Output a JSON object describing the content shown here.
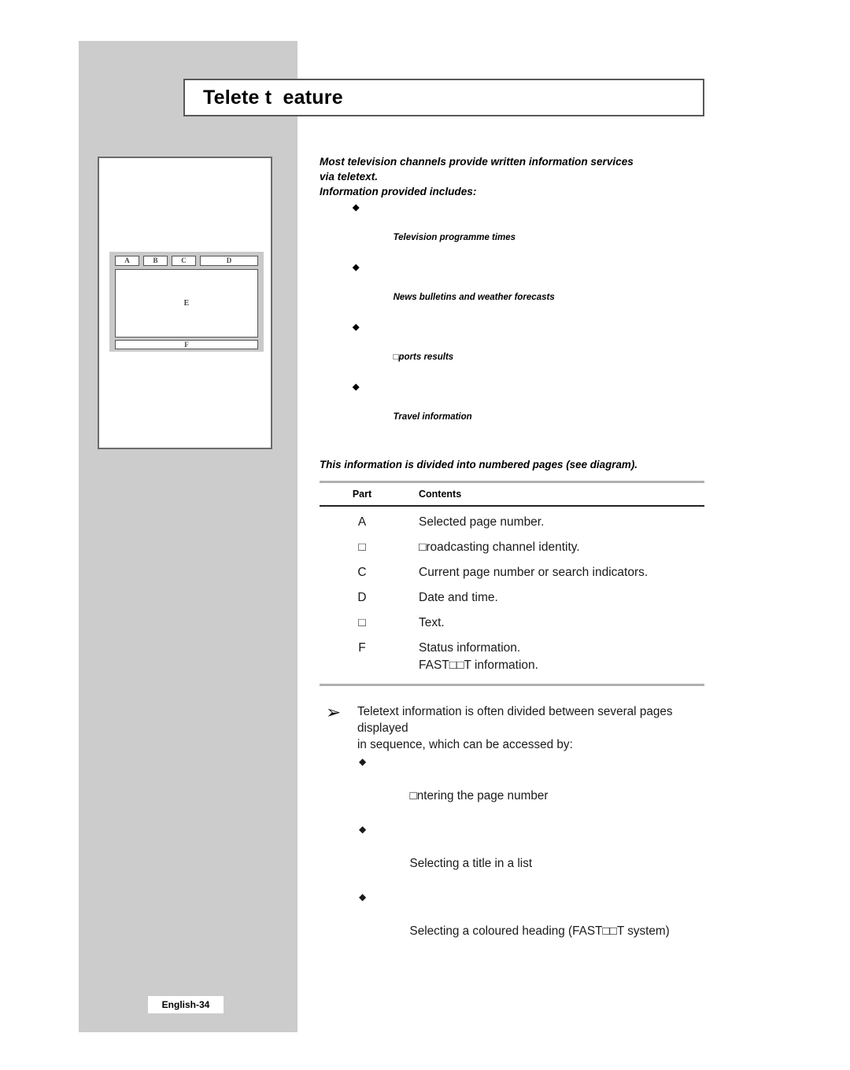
{
  "page": {
    "title": "Telete t  eature",
    "footer_label": "English-34"
  },
  "intro": {
    "line1": "Most television channels provide written information services",
    "line2": "via teletext.",
    "line3": "Information provided includes:",
    "bullets": [
      {
        "glyph": "◆",
        "text": "Television programme times"
      },
      {
        "glyph": "◆",
        "text": "News bulletins and weather forecasts"
      },
      {
        "glyph": "◆",
        "text": "□ports results"
      },
      {
        "glyph": "◆",
        "text": "Travel information"
      }
    ]
  },
  "divided_note": "This information is divided into numbered pages (see diagram).",
  "table": {
    "headers": {
      "part": "Part",
      "contents": "Contents"
    },
    "rows": [
      {
        "part": "A",
        "contents": "Selected page number."
      },
      {
        "part": "□",
        "contents": "□roadcasting channel identity."
      },
      {
        "part": "C",
        "contents": "Current page number or search indicators."
      },
      {
        "part": "D",
        "contents": "Date and time."
      },
      {
        "part": "□",
        "contents": "Text."
      },
      {
        "part": "F",
        "contents": "Status information.\nFAST□□T information."
      }
    ]
  },
  "closing": {
    "arrow_glyph": "➢",
    "paragraph": "Teletext information is often divided between several pages displayed\nin sequence, which can be accessed by:",
    "bullets": [
      {
        "glyph": "◆",
        "text": "□ntering the page number"
      },
      {
        "glyph": "◆",
        "text": "Selecting a title in a list"
      },
      {
        "glyph": "◆",
        "text": "Selecting a coloured heading (FAST□□T system)"
      }
    ]
  },
  "diagram": {
    "top_cells": [
      {
        "label": "A"
      },
      {
        "label": "B"
      },
      {
        "label": "C"
      },
      {
        "label": "D"
      }
    ],
    "screen_label": "E",
    "bottom_label": "F"
  },
  "colors": {
    "band": "#cccccc",
    "panel": "#c9c9c9",
    "rule_grey": "#b0b0b0",
    "rule_black": "#222222",
    "text": "#1a1a1a",
    "missing_glyph": "#b9b9b9"
  }
}
